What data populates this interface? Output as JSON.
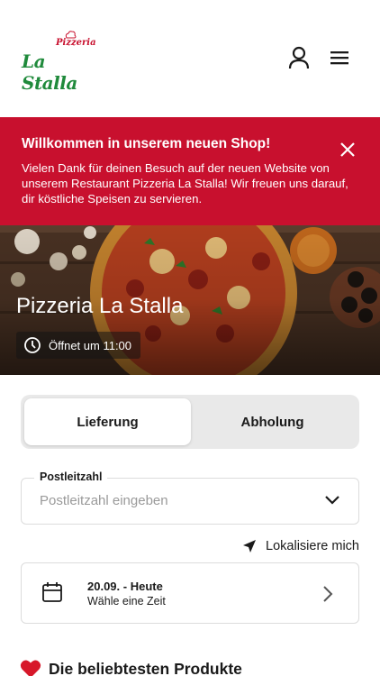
{
  "header": {
    "logo_small": "Pizzeria",
    "logo_big": "La Stalla"
  },
  "banner": {
    "title": "Willkommen in unserem neuen Shop!",
    "text": "Vielen Dank für deinen Besuch auf der neuen Website von unserem Restaurant Pizzeria La Stalla! Wir freuen uns darauf, dir köstliche Speisen zu servieren.",
    "color": "#c8102e"
  },
  "hero": {
    "title": "Pizzeria La Stalla",
    "hours": "Öffnet um 11:00"
  },
  "order_mode": {
    "delivery_label": "Lieferung",
    "pickup_label": "Abholung",
    "selected": "Lieferung"
  },
  "postal": {
    "label": "Postleitzahl",
    "placeholder": "Postleitzahl eingeben",
    "value": ""
  },
  "locate": {
    "label": "Lokalisiere mich"
  },
  "time": {
    "date": "20.09. - Heute",
    "hint": "Wähle eine Zeit"
  },
  "popular": {
    "title": "Die beliebtesten Produkte",
    "icon": "heart-icon"
  },
  "icons": [
    "user-icon",
    "menu-icon",
    "close-icon",
    "clock-icon",
    "chevron-down-icon",
    "location-arrow-icon",
    "calendar-icon",
    "chevron-right-icon",
    "heart-icon"
  ]
}
